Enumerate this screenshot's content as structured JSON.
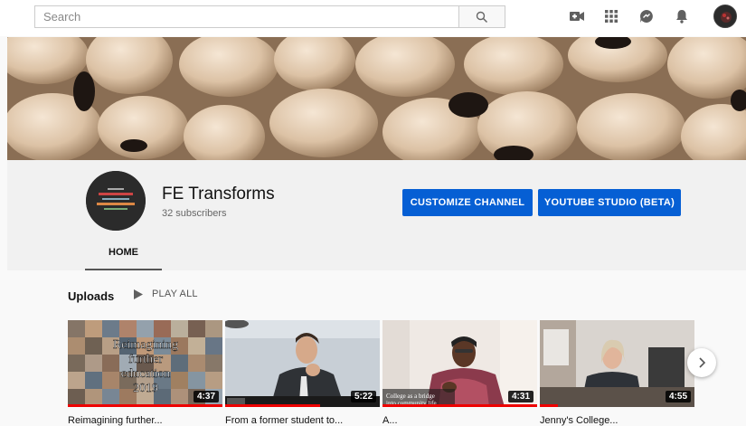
{
  "search": {
    "placeholder": "Search"
  },
  "channel": {
    "name": "FE Transforms",
    "subscribers": "32 subscribers",
    "customize_label": "CUSTOMIZE CHANNEL",
    "studio_label": "YOUTUBE STUDIO (BETA)"
  },
  "tabs": [
    {
      "label": "HOME"
    }
  ],
  "uploads": {
    "label": "Uploads",
    "play_all": "PLAY ALL",
    "videos": [
      {
        "duration": "4:37",
        "overlay_text": [
          "Reimagining",
          "further",
          "education",
          "2019"
        ],
        "title": "Reimagining further..."
      },
      {
        "duration": "5:22",
        "title": "From a former student to..."
      },
      {
        "duration": "4:31",
        "overlay_text": [
          "College as a bridge",
          "into community life"
        ],
        "title": "A..."
      },
      {
        "duration": "4:55",
        "title": "Jenny's College..."
      }
    ]
  },
  "colors": {
    "accent": "#065fd4",
    "progress": "#ee0000"
  },
  "icons": [
    "search-icon",
    "create-video-icon",
    "apps-icon",
    "messages-icon",
    "notifications-bell-icon",
    "play-icon",
    "chevron-right-icon"
  ]
}
